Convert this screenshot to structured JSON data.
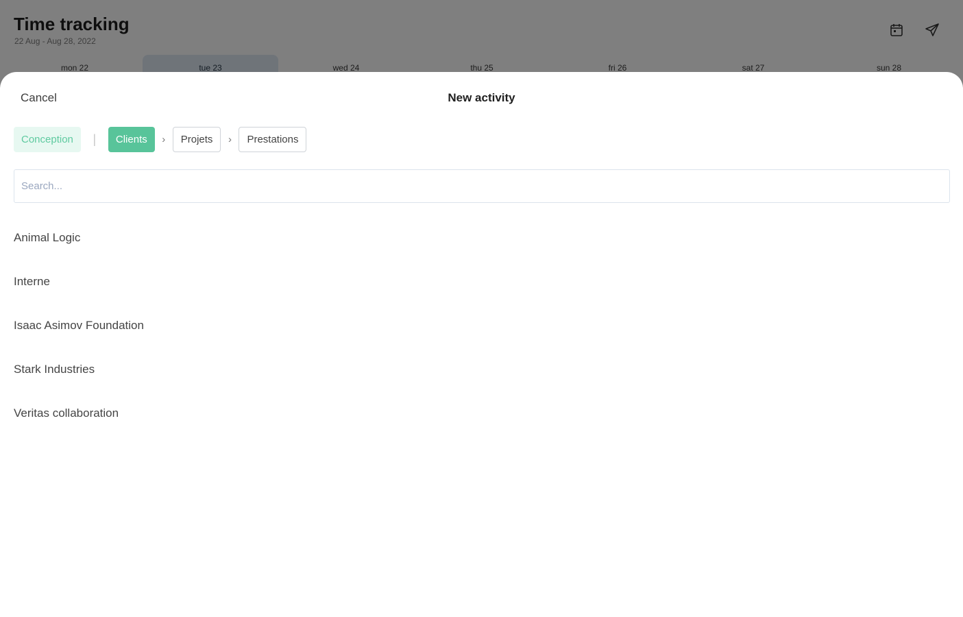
{
  "background": {
    "title": "Time tracking",
    "subtitle": "22 Aug - Aug 28, 2022",
    "icons": [
      "calendar-icon",
      "send-icon"
    ],
    "days": [
      {
        "label": "mon 22"
      },
      {
        "label": "tue 23"
      },
      {
        "label": "wed 24"
      },
      {
        "label": "thu 25"
      },
      {
        "label": "fri 26"
      },
      {
        "label": "sat 27"
      },
      {
        "label": "sun 28"
      }
    ],
    "active_day_index": 1
  },
  "sheet": {
    "cancel_label": "Cancel",
    "title": "New activity",
    "breadcrumb": {
      "category": "Conception",
      "steps": [
        "Clients",
        "Projets",
        "Prestations"
      ],
      "active_step_index": 0
    },
    "search": {
      "placeholder": "Search...",
      "value": ""
    },
    "clients": [
      "Animal Logic",
      "Interne",
      "Isaac Asimov Foundation",
      "Stark Industries",
      "Veritas collaboration"
    ]
  },
  "colors": {
    "accent": "#58c49a",
    "accent_light": "#e7f8f1",
    "overlay": "rgba(0,0,0,0.5)"
  }
}
